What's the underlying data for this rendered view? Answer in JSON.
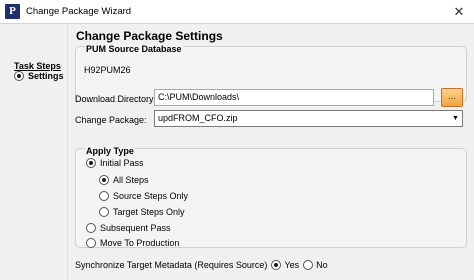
{
  "window": {
    "title": "Change Package Wizard",
    "icon_letter": "P",
    "close_glyph": "✕"
  },
  "sidebar": {
    "heading": "Task Steps",
    "items": [
      {
        "label": "Settings",
        "selected": true
      }
    ]
  },
  "main": {
    "heading": "Change Package Settings",
    "pum_source": {
      "legend": "PUM Source Database",
      "value": "H92PUM26"
    },
    "download_directory": {
      "label": "Download Directory:",
      "value": "C:\\PUM\\Downloads\\",
      "browse_label": "..."
    },
    "change_package": {
      "label": "Change Package:",
      "selected": "updFROM_CFO.zip"
    },
    "apply_type": {
      "legend": "Apply Type",
      "options": [
        {
          "label": "Initial Pass",
          "checked": true
        },
        {
          "label": "All Steps",
          "checked": true
        },
        {
          "label": "Source Steps Only",
          "checked": false
        },
        {
          "label": "Target Steps Only",
          "checked": false
        },
        {
          "label": "Subsequent Pass",
          "checked": false
        },
        {
          "label": "Move To Production",
          "checked": false
        }
      ]
    },
    "sync_metadata": {
      "label": "Synchronize Target Metadata (Requires Source)",
      "yes_label": "Yes",
      "no_label": "No",
      "selected": "Yes"
    }
  }
}
